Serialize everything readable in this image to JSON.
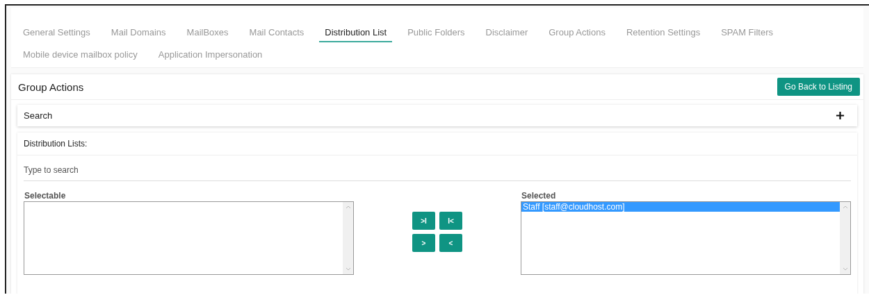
{
  "tabs": [
    {
      "label": "General Settings",
      "selected": false
    },
    {
      "label": "Mail Domains",
      "selected": false
    },
    {
      "label": "MailBoxes",
      "selected": false
    },
    {
      "label": "Mail Contacts",
      "selected": false
    },
    {
      "label": "Distribution List",
      "selected": true
    },
    {
      "label": "Public Folders",
      "selected": false
    },
    {
      "label": "Disclaimer",
      "selected": false
    },
    {
      "label": "Group Actions",
      "selected": false
    },
    {
      "label": "Retention Settings",
      "selected": false
    },
    {
      "label": "SPAM Filters",
      "selected": false
    },
    {
      "label": "Mobile device mailbox policy",
      "selected": false
    },
    {
      "label": "Application Impersonation",
      "selected": false
    }
  ],
  "panel": {
    "title": "Group Actions",
    "back_button": "Go Back to Listing"
  },
  "search_section": {
    "title": "Search",
    "expanded": false
  },
  "distribution_lists": {
    "title": "Distribution Lists:",
    "search": {
      "placeholder": "Type to search"
    },
    "selectable": {
      "label": "Selectable"
    },
    "move_buttons": [
      ">I",
      "I<",
      ">",
      "<"
    ],
    "selected": {
      "label": "Selected",
      "items": [
        {
          "text": "Staff [staff@cloudhost.com]",
          "selected": true
        }
      ]
    }
  }
}
